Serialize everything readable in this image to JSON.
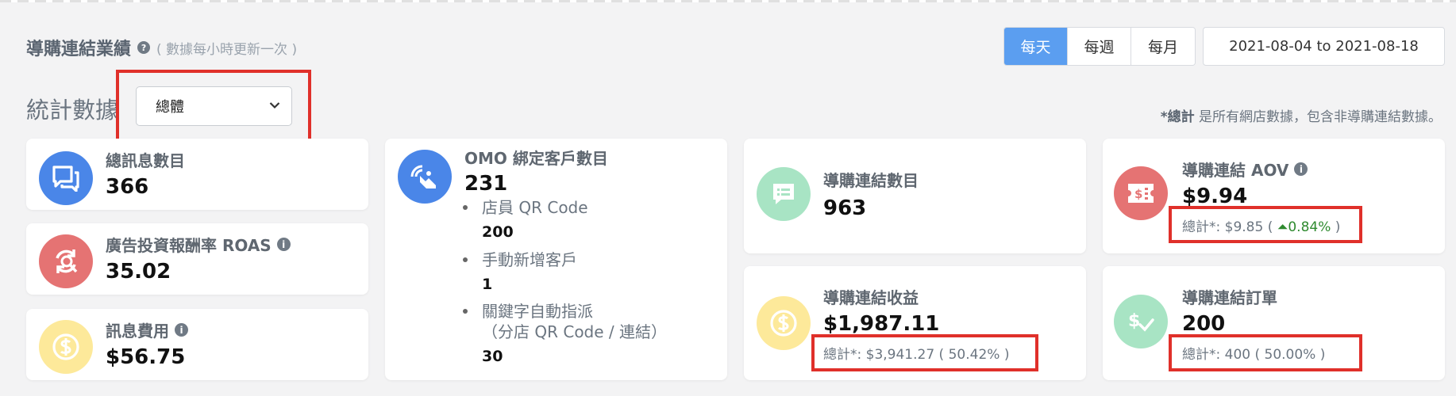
{
  "header": {
    "title": "導購連結業績",
    "subtitle": "( 數據每小時更新一次 )",
    "periods": [
      "每天",
      "每週",
      "每月"
    ],
    "active_period": "每天",
    "date_range": "2021-08-04 to 2021-08-18"
  },
  "stats": {
    "title": "統計數據",
    "selected_scope": "總體",
    "total_note_bold": "*總計",
    "total_note_rest": " 是所有網店數據，包含非導購連結數據。"
  },
  "cards": {
    "total_messages": {
      "label": "總訊息數目",
      "value": "366"
    },
    "roas": {
      "label": "廣告投資報酬率 ROAS",
      "value": "35.02"
    },
    "message_cost": {
      "label": "訊息費用",
      "value": "$56.75"
    },
    "omo": {
      "label": "OMO 綁定客戶數目",
      "value": "231",
      "items": [
        {
          "label": "店員 QR Code",
          "value": "200"
        },
        {
          "label": "手動新增客戶",
          "value": "1"
        },
        {
          "label": "關鍵字自動指派",
          "label2": "（分店 QR Code / 連結）",
          "value": "30"
        }
      ]
    },
    "link_count": {
      "label": "導購連結數目",
      "value": "963"
    },
    "link_revenue": {
      "label": "導購連結收益",
      "value": "$1,987.11",
      "total": "總計*: $3,941.27 ( 50.42% )"
    },
    "aov": {
      "label": "導購連結 AOV",
      "value": "$9.94",
      "total_prefix": "總計*: $9.85 (",
      "total_change": "0.84%",
      "total_suffix": " )"
    },
    "orders": {
      "label": "導購連結訂單",
      "value": "200",
      "total": "總計*: 400 ( 50.00% )"
    }
  },
  "colors": {
    "accent": "#5b9ef0",
    "icon_blue": "#4a86e8",
    "icon_red": "#e57373",
    "icon_yellow": "#fde99a",
    "icon_green": "#a8e4c4",
    "highlight": "#e0302a",
    "positive": "#2f8a2f"
  }
}
